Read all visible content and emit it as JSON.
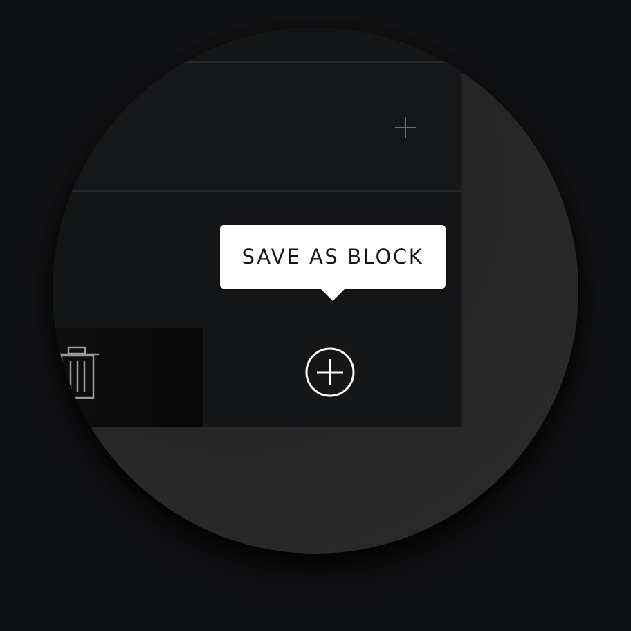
{
  "tooltip": {
    "label": "SAVE AS BLOCK"
  },
  "icons": {
    "add_section": "plus-icon",
    "save_as_block": "circle-plus-icon",
    "delete": "trash-icon"
  },
  "colors": {
    "background": "#111214",
    "panel": "#151617",
    "tooltip_background": "#ffffff",
    "tooltip_text": "#161616",
    "icon_stroke": "#ffffff",
    "muted_icon": "#6d6e70"
  }
}
